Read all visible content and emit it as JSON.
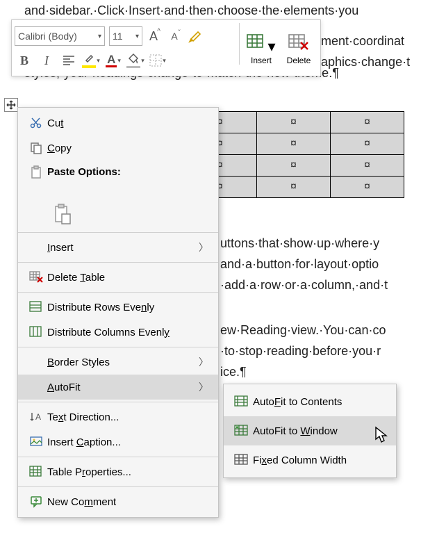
{
  "doc": {
    "line0": "and·sidebar.·Click·Insert·and·then·choose·the·elements·you",
    "line1b": "ment·coordinat",
    "line2b": "aphics·change·t",
    "line3": "styles,·your·headings·change·to·match·the·new·theme.¶",
    "line5b": "uttons·that·show·up·where·y",
    "line6b": "and·a·button·for·layout·optio",
    "line7b": "·add·a·row·or·a·column,·and·t",
    "line8b": "ew·Reading·view.·You·can·co",
    "line9b": "·to·stop·reading·before·you·r",
    "line10b": "ice.¶"
  },
  "cell": "¤",
  "toolbar": {
    "font_name": "Calibri (Body)",
    "font_size": "11",
    "insert": "Insert",
    "delete": "Delete"
  },
  "menu": {
    "cut": "Cut",
    "copy": "Copy",
    "paste_options": "Paste Options:",
    "insert": "Insert",
    "delete_table": "Delete Table",
    "dist_rows": "Distribute Rows Evenly",
    "dist_cols": "Distribute Columns Evenly",
    "border_styles": "Border Styles",
    "autofit": "AutoFit",
    "text_direction": "Text Direction...",
    "insert_caption": "Insert Caption...",
    "table_props": "Table Properties...",
    "new_comment": "New Comment"
  },
  "submenu": {
    "contents": "AutoFit to Contents",
    "window": "AutoFit to Window",
    "fixed": "Fixed Column Width"
  }
}
